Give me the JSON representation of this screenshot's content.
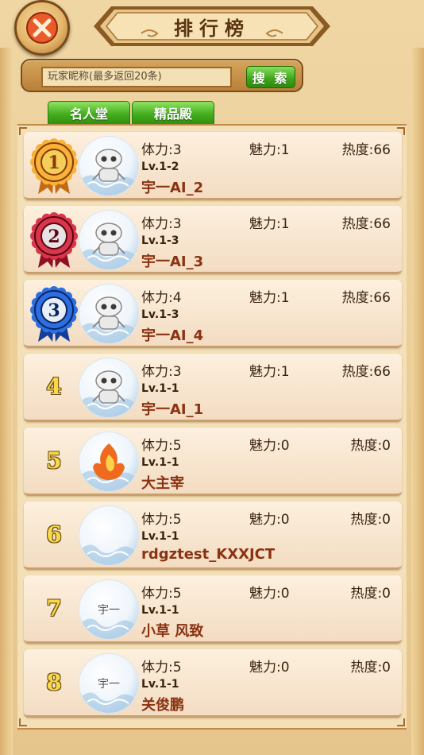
{
  "header": {
    "title": "排行榜"
  },
  "search": {
    "placeholder": "玩家昵称(最多返回20条)",
    "button_label": "搜 索"
  },
  "tabs": [
    {
      "label": "名人堂",
      "active": true
    },
    {
      "label": "精品殿",
      "active": false
    }
  ],
  "colors": {
    "name_red": "#8a3312",
    "tab_green": "#46ae1f",
    "gold_rank": "#f5d94a"
  },
  "rows": [
    {
      "rank": "1",
      "medal": "gold-medal-icon",
      "avatar": "robot-avatar",
      "avatar_text": "",
      "stamina": "体力:3",
      "charm": "魅力:1",
      "heat": "热度:66",
      "level": "Lv.1-2",
      "name": "宇一AI_2"
    },
    {
      "rank": "2",
      "medal": "red-medal-icon",
      "avatar": "robot-avatar",
      "avatar_text": "",
      "stamina": "体力:3",
      "charm": "魅力:1",
      "heat": "热度:66",
      "level": "Lv.1-3",
      "name": "宇一AI_3"
    },
    {
      "rank": "3",
      "medal": "blue-medal-icon",
      "avatar": "robot-avatar",
      "avatar_text": "",
      "stamina": "体力:4",
      "charm": "魅力:1",
      "heat": "热度:66",
      "level": "Lv.1-3",
      "name": "宇一AI_4"
    },
    {
      "rank": "4",
      "medal": "",
      "avatar": "robot-avatar",
      "avatar_text": "",
      "stamina": "体力:3",
      "charm": "魅力:1",
      "heat": "热度:66",
      "level": "Lv.1-1",
      "name": "宇一AI_1"
    },
    {
      "rank": "5",
      "medal": "",
      "avatar": "flame-avatar",
      "avatar_text": "",
      "stamina": "体力:5",
      "charm": "魅力:0",
      "heat": "热度:0",
      "level": "Lv.1-1",
      "name": "大主宰"
    },
    {
      "rank": "6",
      "medal": "",
      "avatar": "bubble-avatar",
      "avatar_text": "",
      "stamina": "体力:5",
      "charm": "魅力:0",
      "heat": "热度:0",
      "level": "Lv.1-1",
      "name": "rdgztest_KXXJCT"
    },
    {
      "rank": "7",
      "medal": "",
      "avatar": "text-avatar",
      "avatar_text": "宇一",
      "stamina": "体力:5",
      "charm": "魅力:0",
      "heat": "热度:0",
      "level": "Lv.1-1",
      "name": "小草  风致"
    },
    {
      "rank": "8",
      "medal": "",
      "avatar": "text-avatar",
      "avatar_text": "宇一",
      "stamina": "体力:5",
      "charm": "魅力:0",
      "heat": "热度:0",
      "level": "Lv.1-1",
      "name": "关俊鹏"
    }
  ]
}
